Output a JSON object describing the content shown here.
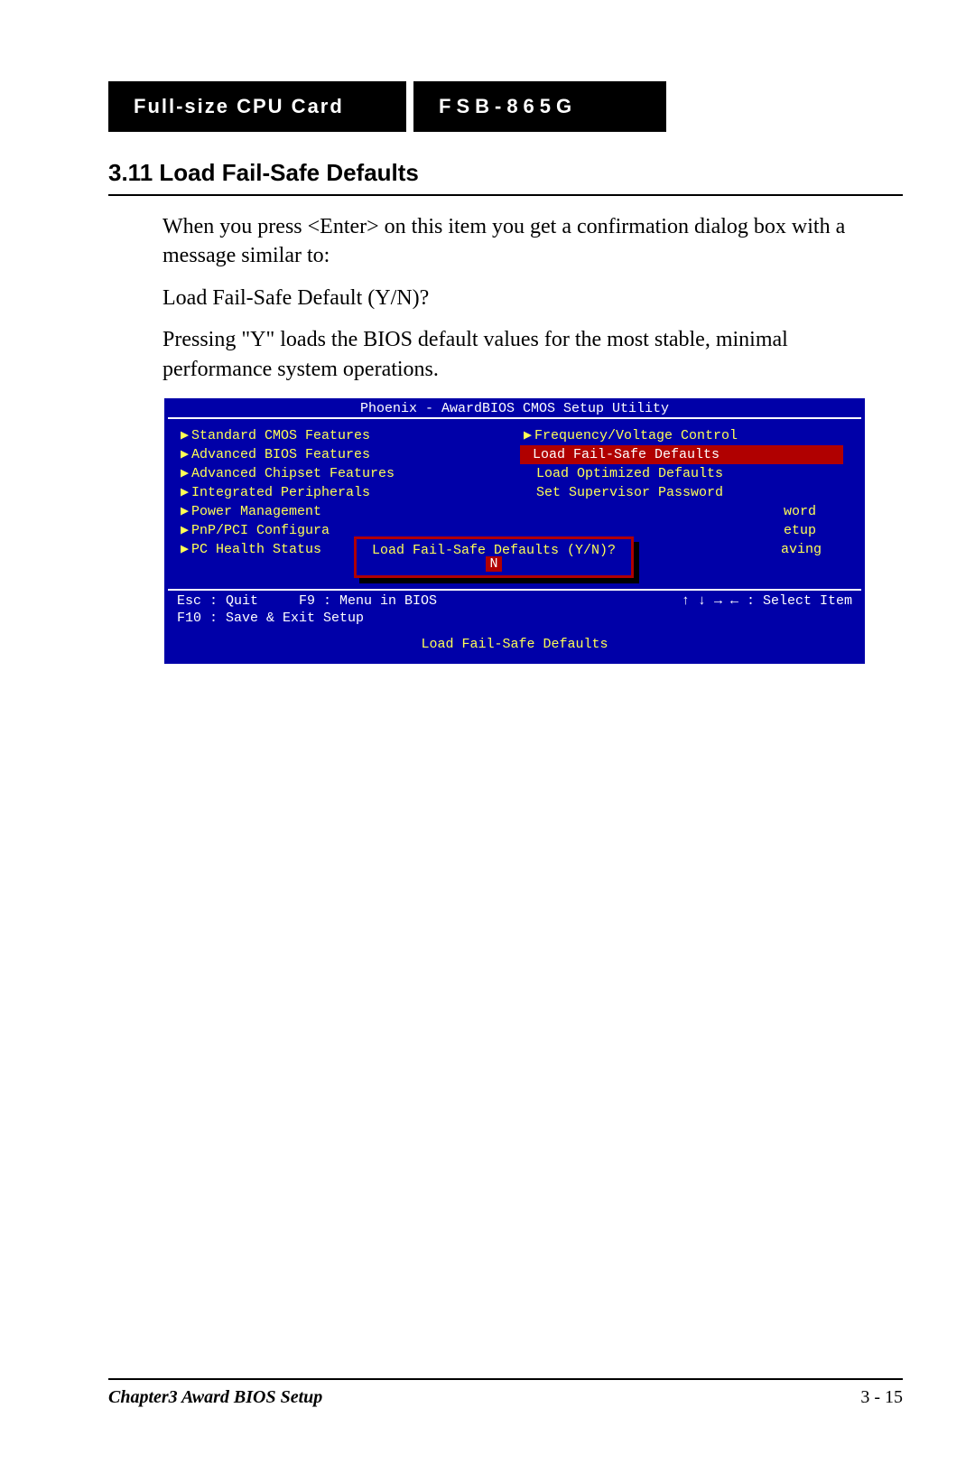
{
  "header": {
    "left": "Full-size CPU Card",
    "right": "FSB-865G"
  },
  "section_title": "3.11 Load Fail-Safe Defaults",
  "paragraphs": {
    "p1": "When you press <Enter> on this item you get a confirmation dialog box with a message similar to:",
    "p2": "Load Fail-Safe Default (Y/N)?",
    "p3": "Pressing \"Y\" loads the BIOS default values for the most stable, minimal performance system operations."
  },
  "bios": {
    "title": "Phoenix - AwardBIOS CMOS Setup Utility",
    "left_items": [
      "Standard CMOS Features",
      "Advanced BIOS Features",
      "Advanced Chipset Features",
      "Integrated Peripherals",
      "Power Management",
      "PnP/PCI Configura",
      "PC Health Status"
    ],
    "right_items": [
      {
        "label": "Frequency/Voltage Control",
        "tri": true,
        "highlight": false
      },
      {
        "label": "Load Fail-Safe Defaults",
        "tri": false,
        "highlight": true
      },
      {
        "label": "Load Optimized Defaults",
        "tri": false,
        "highlight": false
      },
      {
        "label": "Set Supervisor Password",
        "tri": false,
        "highlight": false
      },
      {
        "label": "word",
        "tri": false,
        "highlight": false,
        "frag": true
      },
      {
        "label": "etup",
        "tri": false,
        "highlight": false,
        "frag": true
      },
      {
        "label": "aving",
        "tri": false,
        "highlight": false,
        "frag": true
      }
    ],
    "dialog_prompt": "Load Fail-Safe Defaults (Y/N)?",
    "dialog_response": "N",
    "help_esc": "Esc : Quit",
    "help_f9": "F9 : Menu in BIOS",
    "help_arrows": "↑ ↓ → ←   : Select Item",
    "help_f10": "F10 : Save & Exit Setup",
    "footer": "Load Fail-Safe Defaults"
  },
  "footer": {
    "chapter": "Chapter3 Award BIOS Setup",
    "page": "3 - 15"
  }
}
